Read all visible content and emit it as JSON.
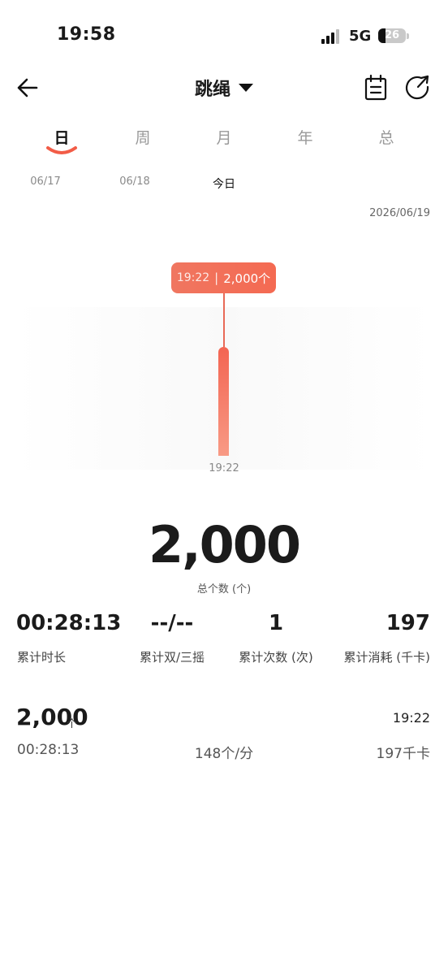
{
  "status_bar": {
    "time": "19:58",
    "network": "5G",
    "battery": "26"
  },
  "header": {
    "title": "跳绳"
  },
  "tabs": [
    {
      "label": "日",
      "active": true
    },
    {
      "label": "周",
      "active": false
    },
    {
      "label": "月",
      "active": false
    },
    {
      "label": "年",
      "active": false
    },
    {
      "label": "总",
      "active": false
    }
  ],
  "dates": [
    {
      "label": "06/17",
      "active": false
    },
    {
      "label": "06/18",
      "active": false
    },
    {
      "label": "今日",
      "active": true
    }
  ],
  "full_date": "2026/06/19",
  "chart_data": {
    "type": "bar",
    "categories": [
      "19:22"
    ],
    "values": [
      2000
    ],
    "tooltip": {
      "time": "19:22",
      "value": "2,000个"
    },
    "x_tick": "19:22",
    "accent": "#f46a52"
  },
  "summary": {
    "total": "2,000",
    "total_label": "总个数 (个)"
  },
  "stats": [
    {
      "value": "00:28:13",
      "label": "累计时长"
    },
    {
      "value": "--/--",
      "label": "累计双/三摇"
    },
    {
      "value": "1",
      "label": "累计次数 (次)"
    },
    {
      "value": "197",
      "label": "累计消耗 (千卡)"
    }
  ],
  "record": {
    "count": "2,000",
    "unit": "个",
    "time": "19:22",
    "duration": "00:28:13",
    "rate": "148个/分",
    "calories": "197千卡"
  }
}
